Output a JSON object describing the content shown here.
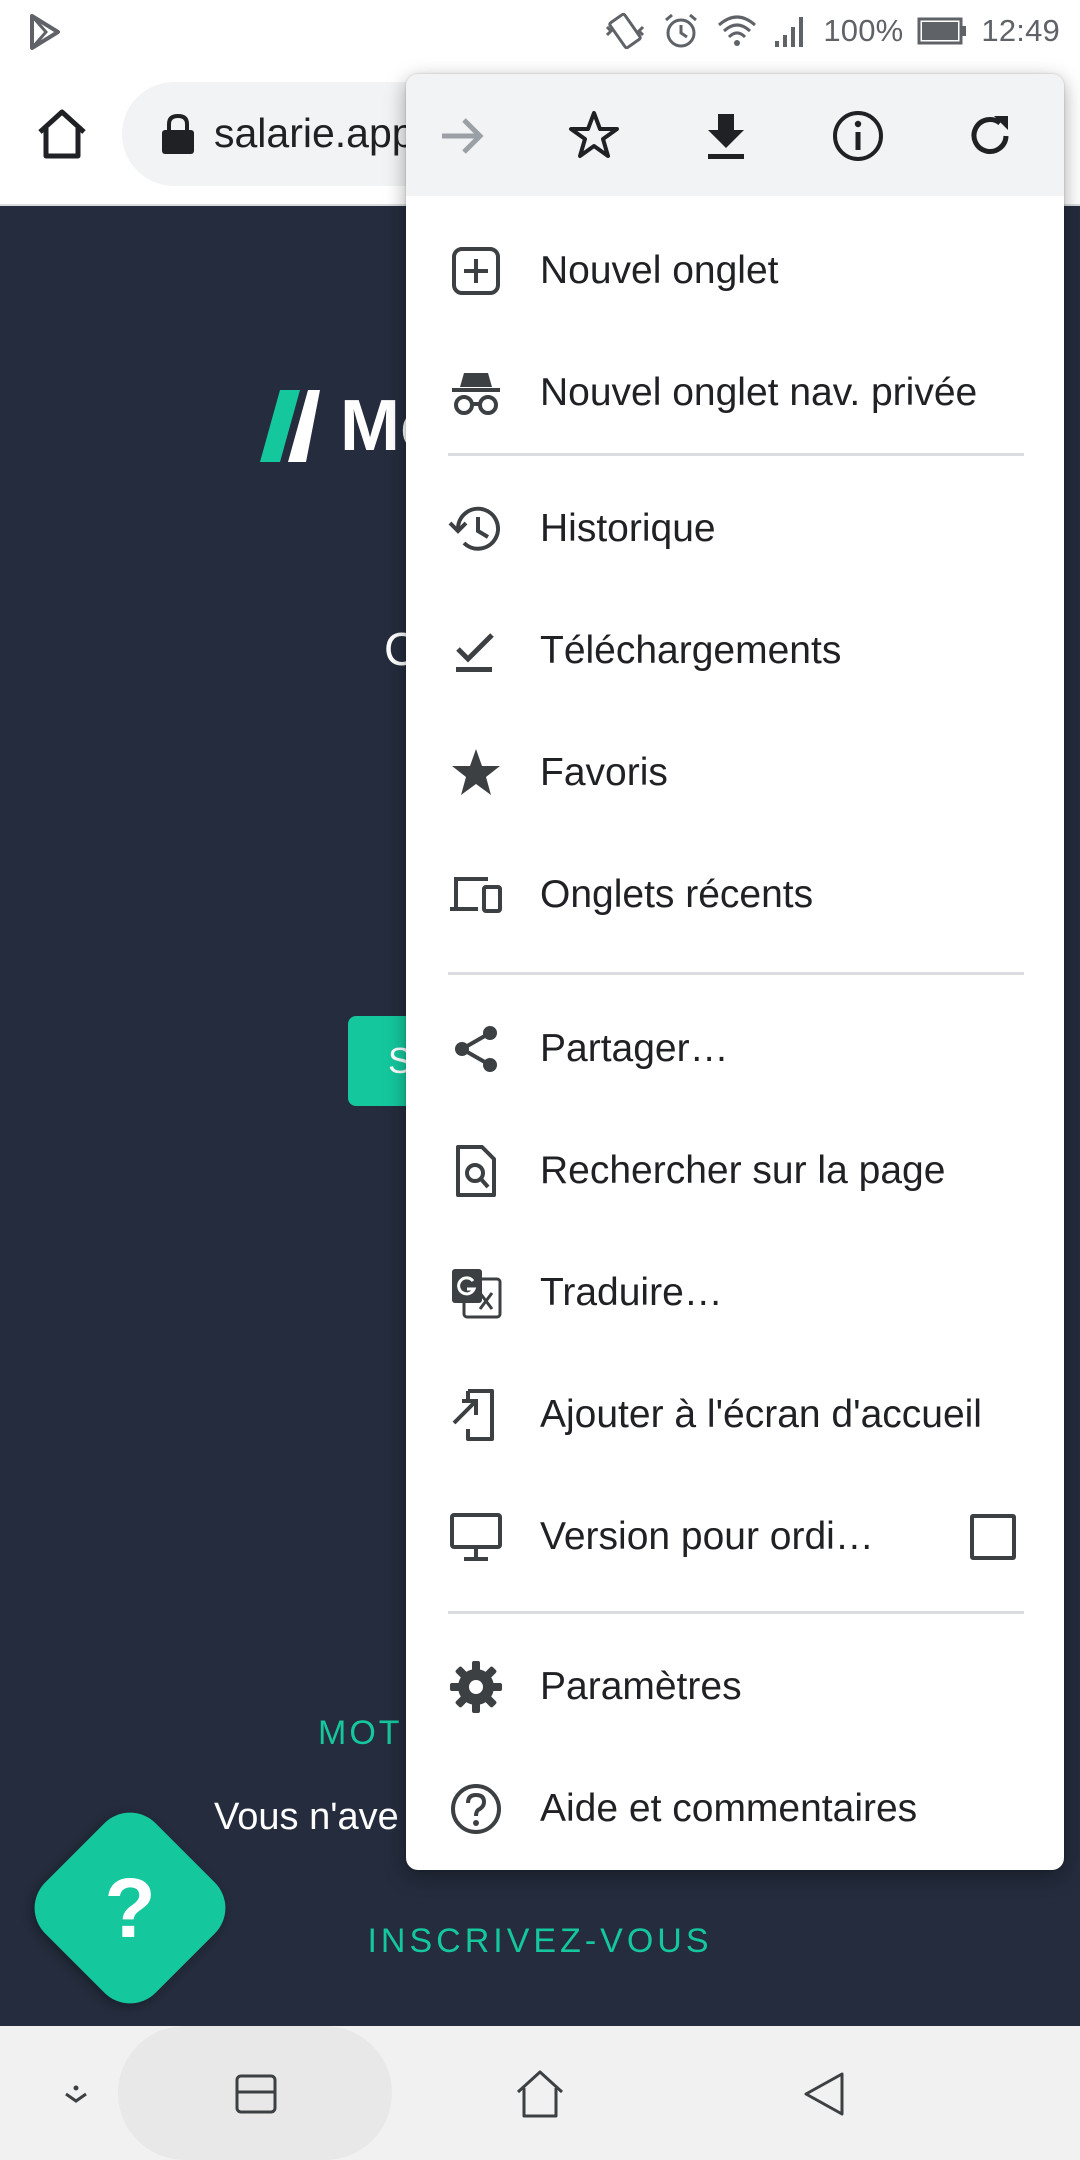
{
  "status_bar": {
    "battery": "100%",
    "time": "12:49"
  },
  "toolbar": {
    "url": "salarie.app"
  },
  "page": {
    "logo_text": "Mo",
    "heading_fragment": "C",
    "submit_fragment": "S",
    "forgot_fragment": "MOT",
    "no_account_fragment": "Vous n'ave",
    "signup_link": "INSCRIVEZ-VOUS",
    "help_symbol": "?"
  },
  "menu": {
    "items": [
      {
        "label": "Nouvel onglet",
        "icon": "new-tab-icon"
      },
      {
        "label": "Nouvel onglet nav. privée",
        "icon": "incognito-icon"
      },
      {
        "label": "Historique",
        "icon": "history-icon"
      },
      {
        "label": "Téléchargements",
        "icon": "downloads-icon"
      },
      {
        "label": "Favoris",
        "icon": "bookmarks-star-icon"
      },
      {
        "label": "Onglets récents",
        "icon": "recent-tabs-icon"
      },
      {
        "label": "Partager…",
        "icon": "share-icon"
      },
      {
        "label": "Rechercher sur la page",
        "icon": "find-in-page-icon"
      },
      {
        "label": "Traduire…",
        "icon": "translate-icon"
      },
      {
        "label": "Ajouter à l'écran d'accueil",
        "icon": "add-to-home-icon"
      },
      {
        "label": "Version pour ordi…",
        "icon": "desktop-icon",
        "checked": false
      },
      {
        "label": "Paramètres",
        "icon": "settings-gear-icon"
      },
      {
        "label": "Aide et commentaires",
        "icon": "help-icon"
      }
    ]
  },
  "colors": {
    "accent": "#14c79d",
    "page_background": "#242c3d"
  }
}
